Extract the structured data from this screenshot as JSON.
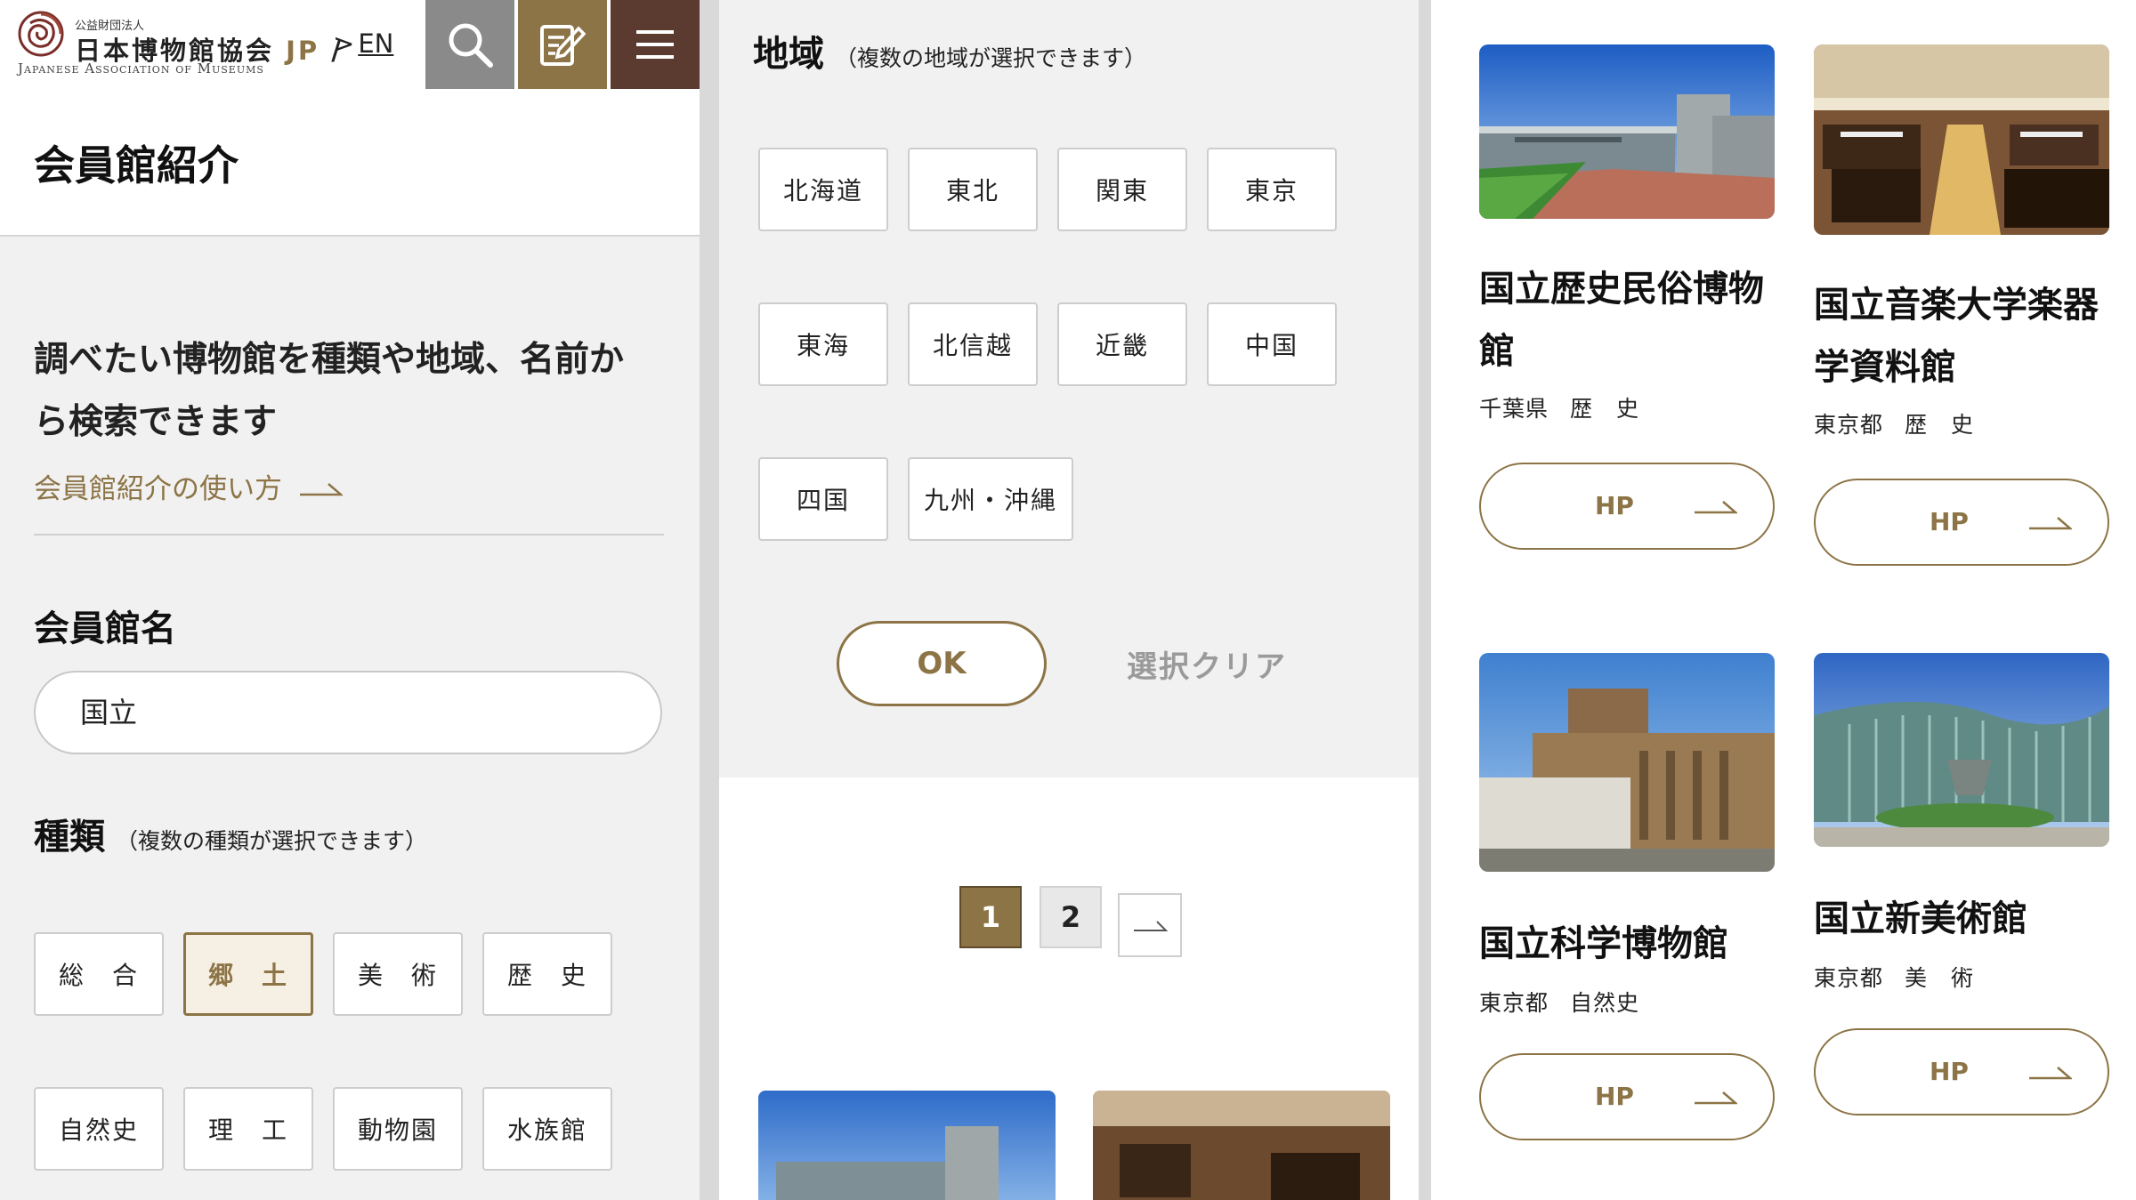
{
  "header": {
    "logo_small": "公益財団法人",
    "logo_main": "日本博物館協会",
    "logo_jp": "JP",
    "logo_slash": "/",
    "logo_sub": "Japanese Association of Museums",
    "lang_prefix": ">",
    "lang_label": "EN"
  },
  "page": {
    "title": "会員館紹介",
    "intro": "調べたい博物館を種類や地域、名前から検索できます",
    "howto_link": "会員館紹介の使い方"
  },
  "name_search": {
    "label": "会員館名",
    "value": "国立"
  },
  "type_filter": {
    "label": "種類",
    "note": "（複数の種類が選択できます）",
    "options": [
      "総　合",
      "郷　土",
      "美　術",
      "歴　史",
      "自然史",
      "理　工",
      "動物園",
      "水族館"
    ],
    "selected": "郷　土"
  },
  "region_filter": {
    "label": "地域",
    "note": "（複数の地域が選択できます）",
    "options": [
      "北海道",
      "東北",
      "関東",
      "東京",
      "東海",
      "北信越",
      "近畿",
      "中国",
      "四国",
      "九州・沖縄"
    ]
  },
  "actions": {
    "ok": "OK",
    "clear": "選択クリア"
  },
  "pagination": {
    "pages": [
      "1",
      "2"
    ],
    "current": "1"
  },
  "results": [
    {
      "name": "国立歴史民俗博物館",
      "pref": "千葉県",
      "type": "歴　史",
      "hp": "HP"
    },
    {
      "name": "国立音楽大学楽器学資料館",
      "pref": "東京都",
      "type": "歴　史",
      "hp": "HP"
    },
    {
      "name": "国立科学博物館",
      "pref": "東京都",
      "type": "自然史",
      "hp": "HP"
    },
    {
      "name": "国立新美術館",
      "pref": "東京都",
      "type": "美　術",
      "hp": "HP"
    }
  ],
  "colors": {
    "accent": "#8c7446",
    "menu_bg": "#5b3a30",
    "search_bg": "#8a8a8a",
    "panel_bg": "#f1f1f1"
  },
  "icons": {
    "search": "search-icon",
    "edit": "edit-icon",
    "menu": "hamburger-menu-icon",
    "arrow": "arrow-right-icon"
  }
}
